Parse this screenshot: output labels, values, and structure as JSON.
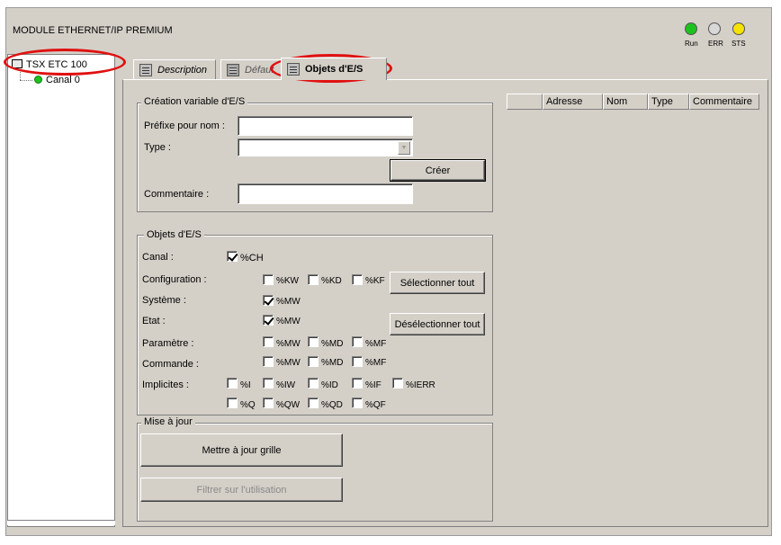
{
  "window": {
    "title": "MODULE ETHERNET/IP PREMIUM"
  },
  "status_leds": [
    {
      "label": "Run",
      "color": "#1ec21e"
    },
    {
      "label": "ERR",
      "color": "#d8d8d8"
    },
    {
      "label": "STS",
      "color": "#f5e200"
    }
  ],
  "tree": {
    "root": "TSX ETC 100",
    "child": "Canal 0",
    "child_status_color": "#1ec21e"
  },
  "tabs": [
    {
      "label": "Description",
      "active": false
    },
    {
      "label": "Défaut",
      "active": false
    },
    {
      "label": "Objets d'E/S",
      "active": true
    }
  ],
  "creation": {
    "title": "Création variable d'E/S",
    "prefix_label": "Préfixe pour nom :",
    "prefix_value": "",
    "type_label": "Type :",
    "type_value": "",
    "create_button": "Créer",
    "comment_label": "Commentaire :",
    "comment_value": ""
  },
  "io_objects": {
    "title": "Objets d'E/S",
    "rows": {
      "canal": "Canal :",
      "configuration": "Configuration :",
      "systeme": "Système :",
      "etat": "Etat :",
      "parametre": "Paramètre :",
      "commande": "Commande :",
      "implicites": "Implicites :"
    },
    "checkboxes": {
      "canal_ch": {
        "label": "%CH",
        "checked": true
      },
      "config_kw": {
        "label": "%KW",
        "checked": false
      },
      "config_kd": {
        "label": "%KD",
        "checked": false
      },
      "config_kf": {
        "label": "%KF",
        "checked": false
      },
      "sys_mw": {
        "label": "%MW",
        "checked": true
      },
      "etat_mw": {
        "label": "%MW",
        "checked": true
      },
      "param_mw": {
        "label": "%MW",
        "checked": false
      },
      "param_md": {
        "label": "%MD",
        "checked": false
      },
      "param_mf": {
        "label": "%MF",
        "checked": false
      },
      "cmd_mw": {
        "label": "%MW",
        "checked": false
      },
      "cmd_md": {
        "label": "%MD",
        "checked": false
      },
      "cmd_mf": {
        "label": "%MF",
        "checked": false
      },
      "imp_i": {
        "label": "%I",
        "checked": false
      },
      "imp_iw": {
        "label": "%IW",
        "checked": false
      },
      "imp_id": {
        "label": "%ID",
        "checked": false
      },
      "imp_if": {
        "label": "%IF",
        "checked": false
      },
      "imp_ierr": {
        "label": "%IERR",
        "checked": false
      },
      "imp_q": {
        "label": "%Q",
        "checked": false
      },
      "imp_qw": {
        "label": "%QW",
        "checked": false
      },
      "imp_qd": {
        "label": "%QD",
        "checked": false
      },
      "imp_qf": {
        "label": "%QF",
        "checked": false
      }
    },
    "select_all_button": "Sélectionner tout",
    "deselect_all_button": "Désélectionner tout"
  },
  "update": {
    "title": "Mise à jour",
    "update_grid_button": "Mettre à jour grille",
    "filter_button": "Filtrer sur l'utilisation"
  },
  "table": {
    "columns": [
      "",
      "Adresse",
      "Nom",
      "Type",
      "Commentaire"
    ],
    "rows": []
  }
}
